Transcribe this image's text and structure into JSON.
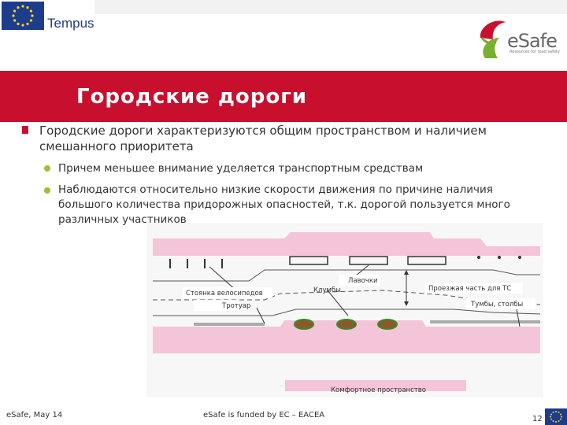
{
  "header": {
    "tempus_label": "Tempus",
    "esafe_label": "eSafe",
    "esafe_tagline": "Resources for road safety"
  },
  "title": "Городские дороги",
  "content": {
    "point": "Городские дороги характеризуются общим пространством и наличием смешанного приоритета",
    "subpoints": [
      "Причем меньшее внимание уделяется транспортным средствам",
      "Наблюдаются относительно низкие скорости движения по причине наличия большого количества придорожных опасностей, т.к. дорогой пользуется много различных участников"
    ]
  },
  "diagram": {
    "labels": {
      "benches": "Лавочки",
      "bicycle_parking": "Стоянка велосипедов",
      "flowerbeds": "Клумбы",
      "sidewalk": "Тротуар",
      "carriageway": "Проезжая часть для ТС",
      "posts": "Тумбы, столбы",
      "comfort_zone": "Комфортное пространство"
    }
  },
  "footer": {
    "left": "eSafe, May 14",
    "center": "eSafe is funded by EC – EACEA",
    "page": "12"
  },
  "colors": {
    "accent_red": "#c8102e",
    "bullet_green": "#9ac230",
    "road_pink": "#f4c4d8",
    "eu_blue": "#1e3c8c"
  }
}
